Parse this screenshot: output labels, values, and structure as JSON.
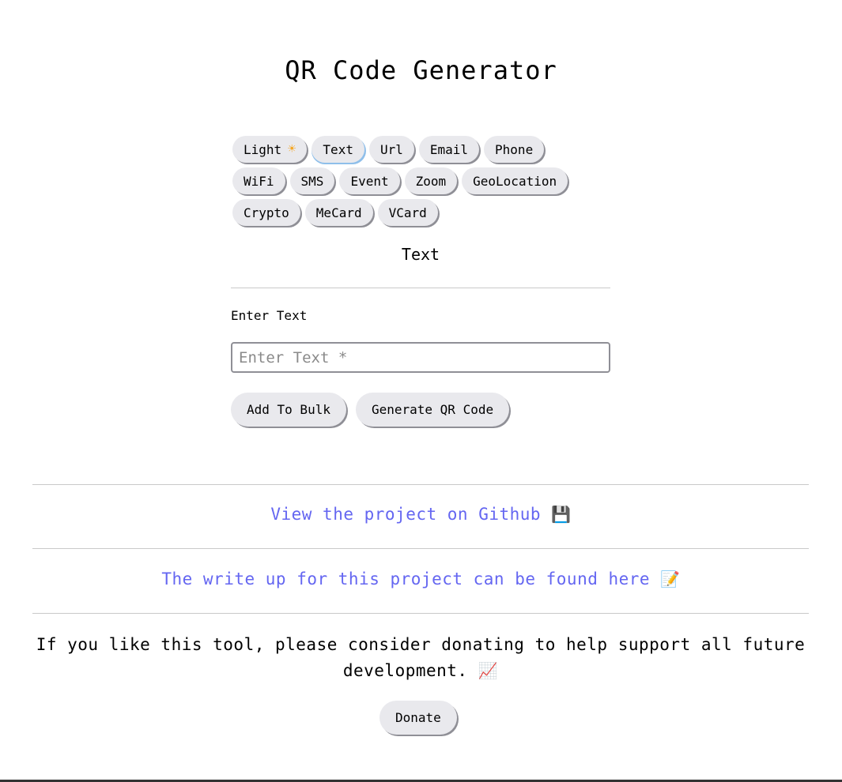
{
  "page": {
    "title": "QR Code Generator"
  },
  "tabs": {
    "row1": [
      {
        "label": "Light",
        "icon": "sun-icon"
      },
      {
        "label": "Text"
      },
      {
        "label": "Url"
      },
      {
        "label": "Email"
      },
      {
        "label": "Phone"
      }
    ],
    "row2": [
      {
        "label": "WiFi"
      },
      {
        "label": "SMS"
      },
      {
        "label": "Event"
      },
      {
        "label": "Zoom"
      },
      {
        "label": "GeoLocation"
      }
    ],
    "row3": [
      {
        "label": "Crypto"
      },
      {
        "label": "MeCard"
      },
      {
        "label": "VCard"
      }
    ],
    "active": "Text"
  },
  "form": {
    "section_title": "Text",
    "field_label": "Enter Text",
    "input_placeholder": "Enter Text *",
    "input_value": "",
    "add_to_bulk_label": "Add To Bulk",
    "generate_label": "Generate QR Code"
  },
  "footer": {
    "github_link": "View the project on Github",
    "github_emoji": "💾",
    "writeup_link": "The write up for this project can be found here",
    "writeup_emoji": "📝",
    "donate_message": "If you like this tool, please consider donating to help support all future development.",
    "donate_emoji": "📈",
    "donate_button": "Donate"
  },
  "colors": {
    "link": "#6466f1",
    "button_bg": "#e9e9ed",
    "active_tab_accent": "#8fbfea",
    "sun": "#f5a623"
  }
}
